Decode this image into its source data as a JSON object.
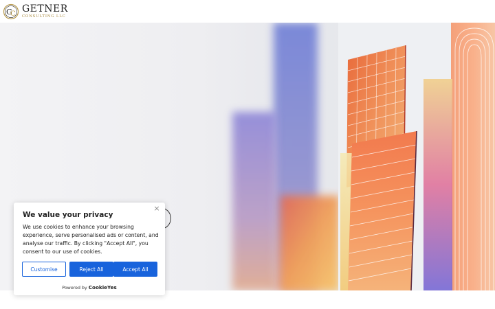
{
  "header": {
    "logo_monogram": "GC",
    "logo_name": "GETNER",
    "logo_sub": "CONSULTING LLC"
  },
  "cookie_banner": {
    "title": "We value your privacy",
    "body": "We use cookies to enhance your browsing experience, serve personalised ads or content, and analyse our traffic. By clicking \"Accept All\", you consent to our use of cookies.",
    "close_symbol": "×",
    "customise_label": "Customise",
    "reject_label": "Reject All",
    "accept_label": "Accept All",
    "powered_by": "Powered by",
    "brand": "CookieYes"
  },
  "colors": {
    "primary": "#1863dc",
    "gold": "#a88a3e",
    "text": "#212121"
  },
  "icons": [
    "logo-monogram-icon",
    "close-icon"
  ]
}
